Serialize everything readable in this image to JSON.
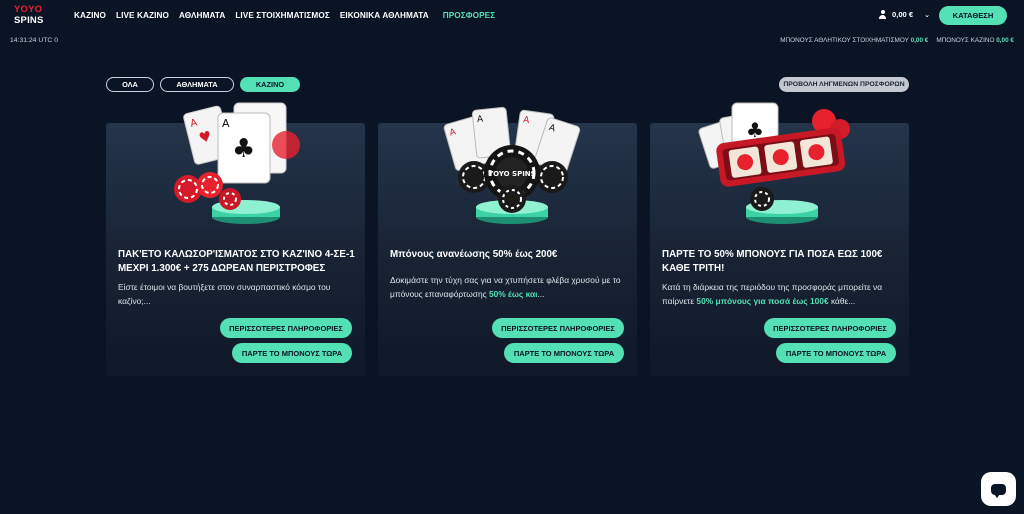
{
  "logo": {
    "line1": "YOYO",
    "line2": "SPINS"
  },
  "nav": [
    {
      "label": "ΚΑΖΙΝΟ"
    },
    {
      "label": "LIVE ΚΑΖΙΝΟ"
    },
    {
      "label": "ΑΘΛΗΜΑΤΑ"
    },
    {
      "label": "LIVE ΣΤΟΙΧΗΜΑΤΙΣΜΟΣ"
    },
    {
      "label": "ΕΙΚΟΝΙΚΑ ΑΘΛΗΜΑΤΑ"
    },
    {
      "label": "ΠΡΟΣΦΟΡΕΣ"
    }
  ],
  "account": {
    "balance": "0,00 €",
    "deposit_label": "ΚΑΤΑΘΕΣΗ"
  },
  "clock": "14:31:24 UTC 0",
  "bonuses": {
    "sports_label": "ΜΠΟΝΟΥΣ ΑΘΛΗΤΙΚΟΥ ΣΤΟΙΧΗΜΑΤΙΣΜΟΥ",
    "sports_amount": "0,00 €",
    "casino_label": "ΜΠΟΝΟΥΣ ΚΑΖΙΝΟ",
    "casino_amount": "0,00 €"
  },
  "filters": {
    "all": "ΟΛΑ",
    "sports": "ΑΘΛΗΜΑΤΑ",
    "casino": "ΚΑΖΙΝΟ",
    "active": "casino"
  },
  "expired_label": "ΠΡΟΒΟΛΗ ΛΗΓΜΕΝΩΝ ΠΡΟΣΦΟΡΩΝ",
  "cards": [
    {
      "title": "ΠΑΚ'ΕΤΟ ΚΑΛΩΣΟΡ'ΙΣΜΑΤΟΣ ΣΤΟ ΚΑΖ'ΙΝΟ 4-ΣΕ-1 ΜΕΧΡΙ 1.300€ + 275 ΔΩΡΕΑΝ ΠΕΡΙΣΤΡΟΦΕΣ",
      "desc": "Είστε έτοιμοι να βουτήξετε στον συναρπαστικό κόσμο του καζίνο;...",
      "desc_hl": "",
      "desc_tail": "",
      "info_label": "ΠΕΡΙΣΣΟΤΕΡΕΣ ΠΛΗΡΟΦΟΡΙΕΣ",
      "claim_label": "ΠΑΡΤΕ ΤΟ ΜΠΟΝΟΥΣ ΤΩΡΑ"
    },
    {
      "title": "Μπόνους ανανέωσης 50% έως 200€",
      "desc": "Δοκιμάστε την τύχη σας για να χτυπήσετε φλέβα χρυσού με το μπόνους επαναφόρτωσης ",
      "desc_hl": "50% έως και",
      "desc_tail": "...",
      "info_label": "ΠΕΡΙΣΣΟΤΕΡΕΣ ΠΛΗΡΟΦΟΡΙΕΣ",
      "claim_label": "ΠΑΡΤΕ ΤΟ ΜΠΟΝΟΥΣ ΤΩΡΑ",
      "chip_text": "YOYO SPINS"
    },
    {
      "title": "ΠΑΡΤΕ ΤΟ 50% ΜΠΟΝΟΥΣ ΓΙΑ ΠΟΣΑ ΕΩΣ 100€ ΚΑΘΕ ΤΡΙΤΗ!",
      "desc": "Κατά τη διάρκεια της περιόδου της προσφοράς μπορείτε να παίρνετε ",
      "desc_hl": "50% μπόνους για ποσά έως 100€",
      "desc_tail": " κάθε...",
      "info_label": "ΠΕΡΙΣΣΟΤΕΡΕΣ ΠΛΗΡΟΦΟΡΙΕΣ",
      "claim_label": "ΠΑΡΤΕ ΤΟ ΜΠΟΝΟΥΣ ΤΩΡΑ"
    }
  ],
  "colors": {
    "accent": "#53e0b4",
    "background": "#0b1424",
    "red": "#e8212f"
  }
}
